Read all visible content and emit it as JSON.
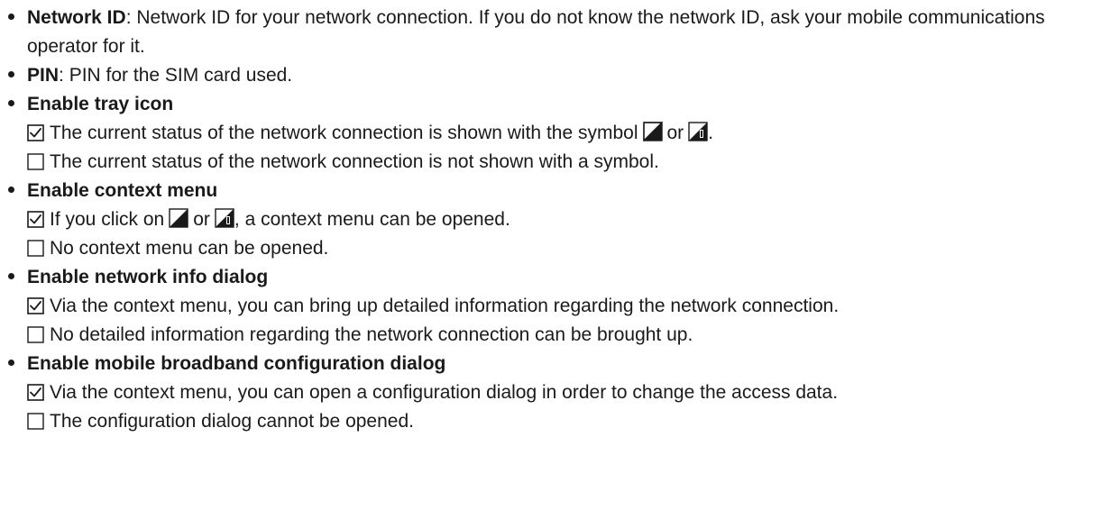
{
  "items": [
    {
      "term": "Network ID",
      "separator": ":",
      "description": "Network ID for your network connection. If you do not know the network ID, ask your mobile communications operator for it."
    },
    {
      "term": "PIN",
      "separator": ":",
      "description": "PIN for the SIM card used."
    },
    {
      "term": "Enable tray icon",
      "checked_text_before": "The current status of the network connection is shown with the symbol",
      "conj": "or",
      "checked_text_after": ".",
      "unchecked_text": "The current status of the network connection is not shown with a symbol."
    },
    {
      "term": "Enable context menu",
      "checked_text_before": "If you click on",
      "conj": "or",
      "checked_text_after": ", a context menu can be opened.",
      "unchecked_text": "No context menu can be opened."
    },
    {
      "term": "Enable network info dialog",
      "checked_text": "Via the context menu, you can bring up detailed information regarding the network connection.",
      "unchecked_text": "No detailed information regarding the network connection can be brought up."
    },
    {
      "term": "Enable mobile broadband configuration dialog",
      "checked_text": "Via the context menu, you can open a configuration dialog in order to change the access data.",
      "unchecked_text": "The configuration dialog cannot be opened."
    }
  ],
  "icons": {
    "checked": "checkbox-checked-icon",
    "unchecked": "checkbox-unchecked-icon",
    "signal_a": "signal-strength-icon",
    "signal_b": "signal-bars-icon"
  }
}
